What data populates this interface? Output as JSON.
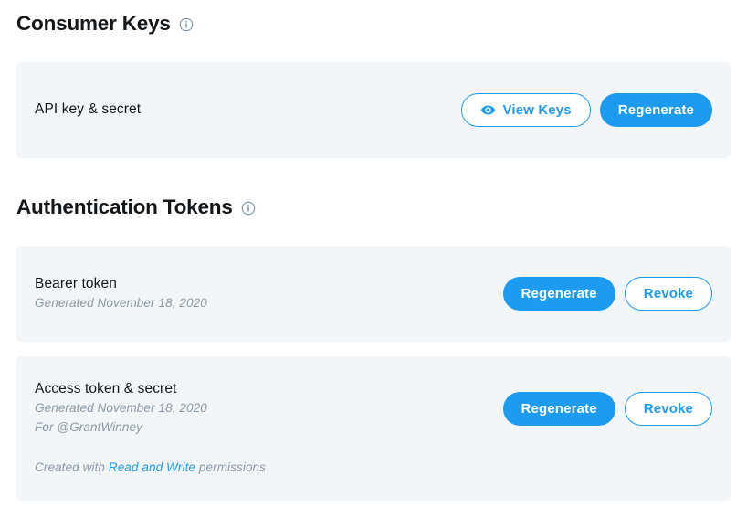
{
  "colors": {
    "accent": "#1d9bf0",
    "card_background": "#f2f6f9",
    "page_background": "#ffffff",
    "heading_text": "#14171a",
    "muted_text": "#8b98a5"
  },
  "sections": {
    "consumer_keys": {
      "heading": "Consumer Keys",
      "info_icon": "info-circle-icon",
      "card": {
        "title": "API key & secret",
        "buttons": [
          {
            "label": "View Keys",
            "style": "outline",
            "icon": "eye-icon"
          },
          {
            "label": "Regenerate",
            "style": "primary",
            "icon": null
          }
        ]
      }
    },
    "authentication_tokens": {
      "heading": "Authentication Tokens",
      "info_icon": "info-circle-icon",
      "cards": [
        {
          "title": "Bearer token",
          "generated": "Generated November 18, 2020",
          "buttons": [
            {
              "label": "Regenerate",
              "style": "primary"
            },
            {
              "label": "Revoke",
              "style": "outline"
            }
          ]
        },
        {
          "title": "Access token & secret",
          "generated": "Generated November 18, 2020",
          "owner": "For @GrantWinney",
          "permissions": {
            "prefix": "Created with ",
            "link": "Read and Write",
            "suffix": " permissions"
          },
          "buttons": [
            {
              "label": "Regenerate",
              "style": "primary"
            },
            {
              "label": "Revoke",
              "style": "outline"
            }
          ]
        }
      ]
    }
  }
}
